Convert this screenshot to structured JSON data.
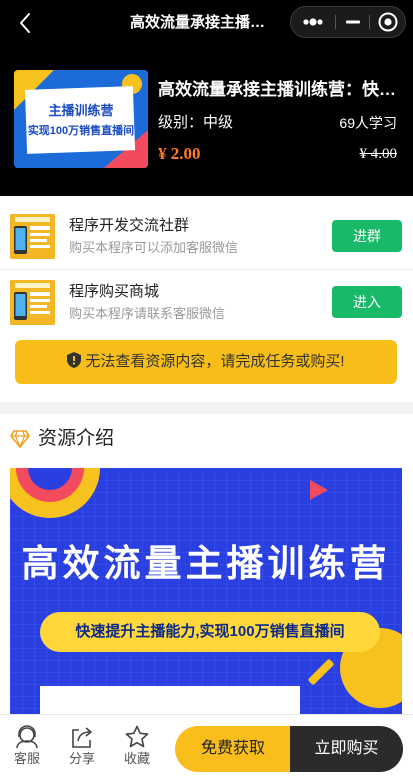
{
  "nav": {
    "title": "高效流量承接主播训练营：快速提升主播能力"
  },
  "product": {
    "cover_line1": "主播训练营",
    "cover_line2": "实现100万销售直播间",
    "title": "高效流量承接主播训练营：快速提升主播能力",
    "level": "级别：中级",
    "learners": "69人学习",
    "price": "¥ 2.00",
    "original_price": "¥ 4.00"
  },
  "promos": [
    {
      "title": "程序开发交流社群",
      "subtitle": "购买本程序可以添加客服微信",
      "button": "进群"
    },
    {
      "title": "程序购买商城",
      "subtitle": "购买本程序请联系客服微信",
      "button": "进入"
    }
  ],
  "notice": "无法查看资源内容，请完成任务或购买!",
  "resource": {
    "title": "资源介绍",
    "banner_title": "高效流量主播训练营",
    "banner_sub": "快速提升主播能力,实现100万销售直播间"
  },
  "tabbar": {
    "service": "客服",
    "share": "分享",
    "collect": "收藏",
    "free": "免费获取",
    "buy": "立即购买"
  },
  "colors": {
    "accent_yellow": "#f7be1a",
    "green": "#19b96a",
    "price_orange": "#ff7f23",
    "dark": "#2b2b2b"
  }
}
